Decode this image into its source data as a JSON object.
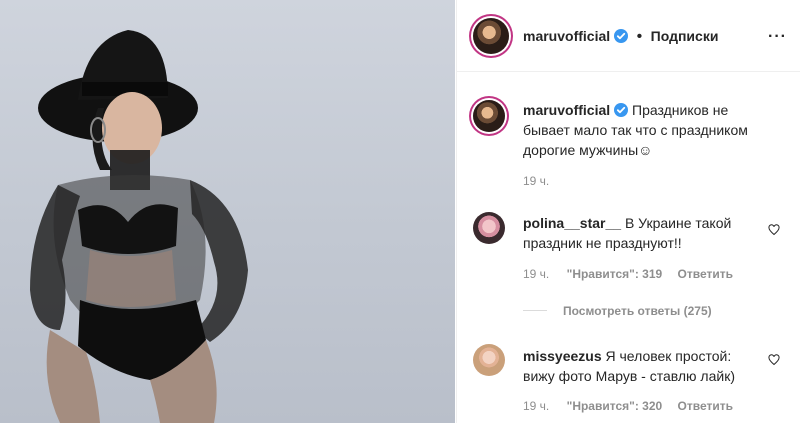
{
  "post": {
    "author": "maruvofficial",
    "follow_status": "Подписки",
    "separator": "•",
    "more_label": "···",
    "caption": "Праздников не бывает мало так что с праздником дорогие мужчины☺",
    "caption_time": "19 ч."
  },
  "comments": [
    {
      "username": "polina__star__",
      "text": "В Украине такой праздник не празднуют!!",
      "time": "19 ч.",
      "likes": "\"Нравится\": 319",
      "reply_label": "Ответить",
      "view_replies": "Посмотреть ответы (275)"
    },
    {
      "username": "missyeezus",
      "text": "Я человек простой: вижу фото Марув - ставлю лайк)",
      "time": "19 ч.",
      "likes": "\"Нравится\": 320",
      "reply_label": "Ответить"
    }
  ],
  "colors": {
    "verified": "#3897f0",
    "text": "#262626",
    "muted": "#8e8e8e",
    "story_ring": "#c13584"
  }
}
